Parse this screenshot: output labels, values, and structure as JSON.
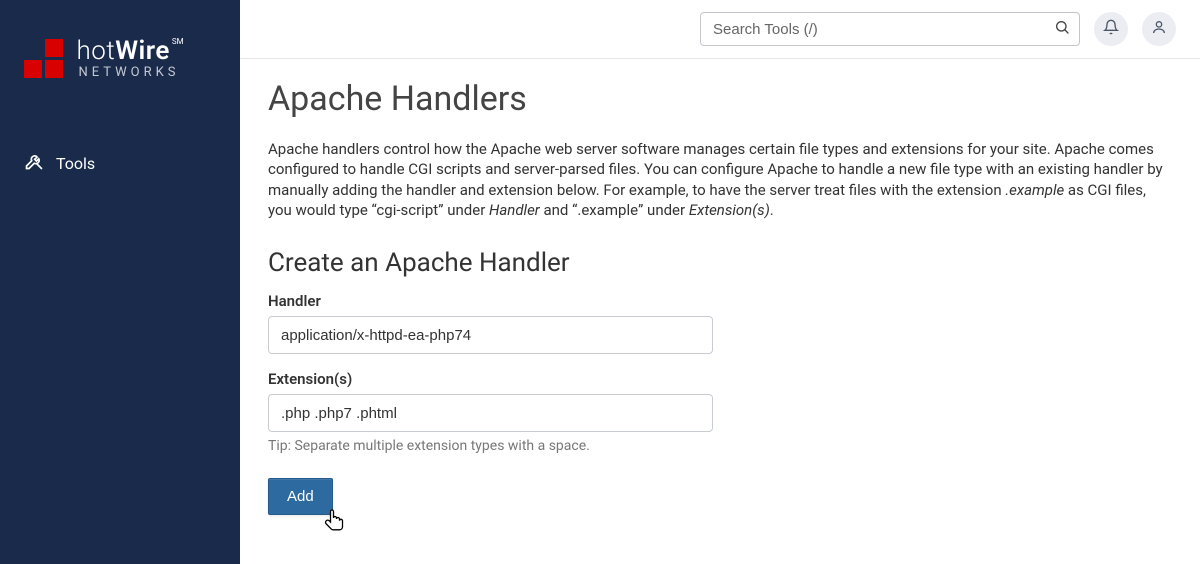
{
  "brand": {
    "main_prefix": "hot",
    "main_bold": "Wire",
    "sm": "SM",
    "sub": "NETWORKS"
  },
  "sidebar": {
    "tools_label": "Tools"
  },
  "topbar": {
    "search_placeholder": "Search Tools (/)"
  },
  "page": {
    "title": "Apache Handlers",
    "desc_pre": "Apache handlers control how the Apache web server software manages certain file types and extensions for your site. Apache comes configured to handle CGI scripts and server-parsed files. You can configure Apache to handle a new file type with an existing handler by manually adding the handler and extension below. For example, to have the server treat files with the extension ",
    "desc_em1": ".example",
    "desc_mid1": " as CGI files, you would type “cgi-script” under ",
    "desc_em2": "Handler",
    "desc_mid2": " and “.example” under ",
    "desc_em3": "Extension(s)",
    "desc_end": "."
  },
  "form": {
    "section_title": "Create an Apache Handler",
    "handler_label": "Handler",
    "handler_value": "application/x-httpd-ea-php74",
    "extensions_label": "Extension(s)",
    "extensions_value": ".php .php7 .phtml",
    "hint": "Tip: Separate multiple extension types with a space.",
    "add_label": "Add"
  }
}
